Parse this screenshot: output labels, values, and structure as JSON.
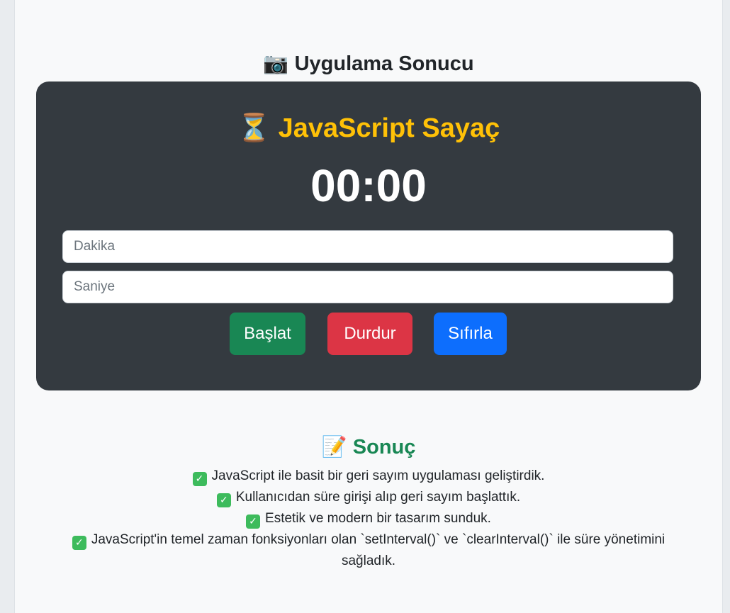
{
  "section": {
    "icon": "camera-icon",
    "icon_glyph": "📷",
    "title": "Uygulama Sonucu"
  },
  "app": {
    "icon": "hourglass-icon",
    "icon_glyph": "⏳",
    "title": "JavaScript Sayaç",
    "timer": "00:00",
    "minutes_placeholder": "Dakika",
    "seconds_placeholder": "Saniye",
    "minutes_value": "",
    "seconds_value": "",
    "buttons": {
      "start": "Başlat",
      "stop": "Durdur",
      "reset": "Sıfırla"
    },
    "colors": {
      "card": "#343a40",
      "title": "#ffc107",
      "start": "#198754",
      "stop": "#dc3545",
      "reset": "#0d6efd"
    }
  },
  "result": {
    "icon": "memo-icon",
    "icon_glyph": "📝",
    "title": "Sonuç",
    "title_color": "#198754",
    "check_icon": "check-mark-icon",
    "items": [
      "JavaScript ile basit bir geri sayım uygulaması geliştirdik.",
      "Kullanıcıdan süre girişi alıp geri sayım başlattık.",
      "Estetik ve modern bir tasarım sunduk.",
      "JavaScript'in temel zaman fonksiyonları olan `setInterval()` ve `clearInterval()` ile süre yönetimini sağladık."
    ]
  }
}
